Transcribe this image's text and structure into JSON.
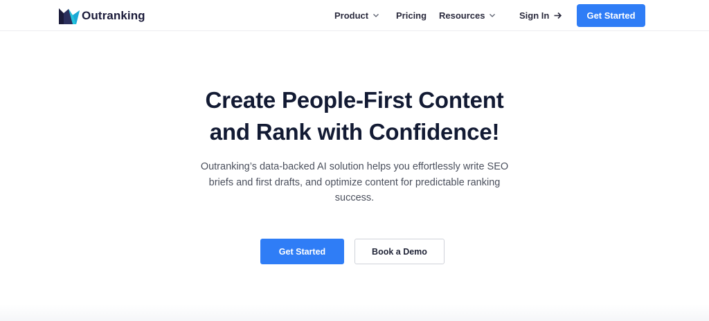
{
  "brand": {
    "name": "Outranking",
    "colors": {
      "accent": "#2f7df6",
      "logo_dark": "#1b1b3a",
      "logo_cyan": "#23c3dd"
    }
  },
  "header": {
    "nav": [
      {
        "label": "Product",
        "icon": "chevron-down-icon"
      },
      {
        "label": "Pricing"
      },
      {
        "label": "Resources",
        "icon": "chevron-down-icon"
      }
    ],
    "sign_in": {
      "label": "Sign In",
      "icon": "arrow-right-icon"
    },
    "cta_label": "Get Started"
  },
  "hero": {
    "title_line1": "Create People-First Content",
    "title_line2": "and Rank with Confidence!",
    "subtitle": "Outranking’s data-backed AI solution helps you effortlessly write SEO briefs and first drafts, and optimize content for predictable ranking success.",
    "primary_cta": "Get Started",
    "secondary_cta": "Book a Demo"
  }
}
